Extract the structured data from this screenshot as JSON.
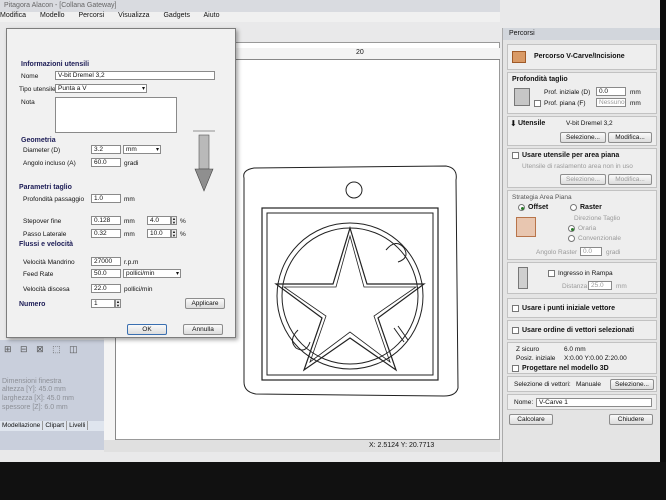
{
  "window": {
    "title": "Pitagora Alacon - [Collana Gateway]"
  },
  "menu": {
    "items": [
      "Modifica",
      "Modello",
      "Percorsi",
      "Visualizza",
      "Gadgets",
      "Aiuto"
    ]
  },
  "ruler": {
    "top_label": "20"
  },
  "status": {
    "coords": "X: 2.5124 Y: 20.7713"
  },
  "left_panel": {
    "ghost_lines": [
      "Dimensioni finestra",
      "altezza  [Y]: 45.0 mm",
      "larghezza  [X]: 45.0 mm",
      "spessore  [Z]: 6.0 mm"
    ],
    "tabs": [
      "Modellazione",
      "Clipart",
      "Livelli"
    ]
  },
  "dialog": {
    "sec_info": "Informazioni utensili",
    "name_label": "Nome",
    "name_value": "V-bit Dremel 3,2",
    "tool_type_label": "Tipo utensile",
    "tool_type_value": "Punta a V",
    "notes_label": "Nota",
    "sec_geometry": "Geometria",
    "diameter_label": "Diameter (D)",
    "diameter_value": "3.2",
    "diameter_unit": "mm",
    "angle_label": "Angolo incluso (A)",
    "angle_value": "60.0",
    "angle_unit": "gradi",
    "sec_cut": "Parametri taglio",
    "pass_depth_label": "Profondità passaggio",
    "pass_depth_value": "1.0",
    "pass_depth_unit": "mm",
    "stepover_label": "Stepover fine",
    "stepover_value": "0.128",
    "stepover_unit": "mm",
    "stepover_pct": "4.0",
    "passo_label": "Passo Laterale",
    "passo_value": "0.32",
    "passo_unit": "mm",
    "passo_pct": "10.0",
    "pct": "%",
    "sec_feeds": "Flussi e velocità",
    "spindle_label": "Velocità Mandrino",
    "spindle_value": "27000",
    "spindle_unit": "r.p.m",
    "feed_label": "Feed Rate",
    "feed_value": "50.0",
    "feed_unit": "pollici/min",
    "plunge_label": "Velocità discesa",
    "plunge_value": "22.0",
    "plunge_unit": "pollici/min",
    "number_label": "Numero",
    "number_value": "1",
    "apply_label": "Applicare",
    "ok_label": "OK",
    "cancel_label": "Annulla"
  },
  "panel": {
    "title": "Percorsi",
    "header": "Percorso V-Carve/Incisione",
    "depth_title": "Profondità taglio",
    "start_depth_label": "Prof. iniziale (D)",
    "start_depth_value": "0.0",
    "start_depth_unit": "mm",
    "flat_depth_label": "Prof. piana (F)",
    "flat_depth_value": "Nessuno",
    "tool_title": "Utensile",
    "tool_name": "V-bit Dremel 3,2",
    "select_label": "Selezione...",
    "edit_label": "Modifica...",
    "flat_tool_title": "Usare utensile per area piana",
    "flat_tool_hint": "Utensile di raslamento area non in uso",
    "select2_label": "Selezione...",
    "edit2_label": "Modifica...",
    "strategy_title": "Strategia Area Piana",
    "offset_label": "Offset",
    "raster_label": "Raster",
    "direction_label": "Direzione Taglio",
    "climb_label": "Oraria",
    "conv_label": "Convenzionale",
    "raster_angle_label": "Angolo Raster",
    "raster_angle_value": "0.0",
    "raster_angle_unit": "gradi",
    "ramp_label": "Ingresso in Rampa",
    "distance_label": "Distanza",
    "distance_value": "25.0",
    "distance_unit": "mm",
    "start_points_label": "Usare i punti iniziale vettore",
    "vector_order_label": "Usare ordine di vettori selezionati",
    "zsafe_label": "Z sicuro",
    "zsafe_value": "6.0 mm",
    "home_label": "Posiz. iniziale",
    "home_value": "X:0.00 Y:0.00 Z:20.00",
    "project_label": "Progettare nel modello 3D",
    "vector_sel_label": "Selezione di vettori:",
    "vector_sel_value": "Manuale",
    "vector_sel_btn": "Selezione...",
    "toolpath_name_label": "Nome:",
    "toolpath_name_value": "V-Carve 1",
    "calc_label": "Calcolare",
    "close_label": "Chiudere"
  },
  "colors": {
    "accent": "#1c1c56",
    "panel_bg": "#e4e4e4",
    "icon": "#d99a66"
  }
}
